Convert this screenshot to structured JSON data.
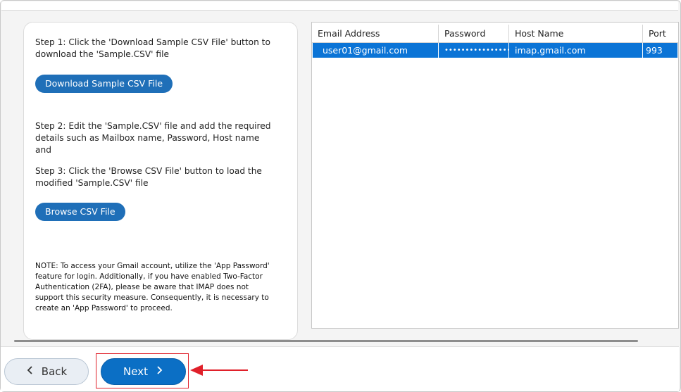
{
  "instructions": {
    "step1": "Step 1: Click the 'Download Sample CSV File' button to download the 'Sample.CSV' file",
    "download_button": "Download Sample CSV File",
    "step2": "Step 2: Edit the 'Sample.CSV' file and add the required details such as Mailbox name, Password, Host name and",
    "step3": "Step 3: Click the 'Browse CSV File' button to load the modified 'Sample.CSV' file",
    "browse_button": "Browse CSV File",
    "note": "NOTE: To access your Gmail account, utilize the 'App Password' feature for login. Additionally, if you have enabled Two-Factor Authentication (2FA), please be aware that IMAP does not support this security measure. Consequently, it is necessary to create an 'App Password' to proceed."
  },
  "grid": {
    "columns": [
      "Email Address",
      "Password",
      "Host Name",
      "Port"
    ],
    "rows": [
      {
        "email": "user01@gmail.com",
        "password": "••••••••••••••••...",
        "host": "imap.gmail.com",
        "port": "993",
        "selected": true
      }
    ]
  },
  "footer": {
    "back_label": "Back",
    "next_label": "Next"
  },
  "colors": {
    "accent": "#0b6fc5",
    "selection": "#0b74d6",
    "highlight": "#e0202a"
  },
  "icons": {
    "back": "chevron-left-icon",
    "next": "chevron-right-icon",
    "annotation": "red-arrow-icon"
  }
}
